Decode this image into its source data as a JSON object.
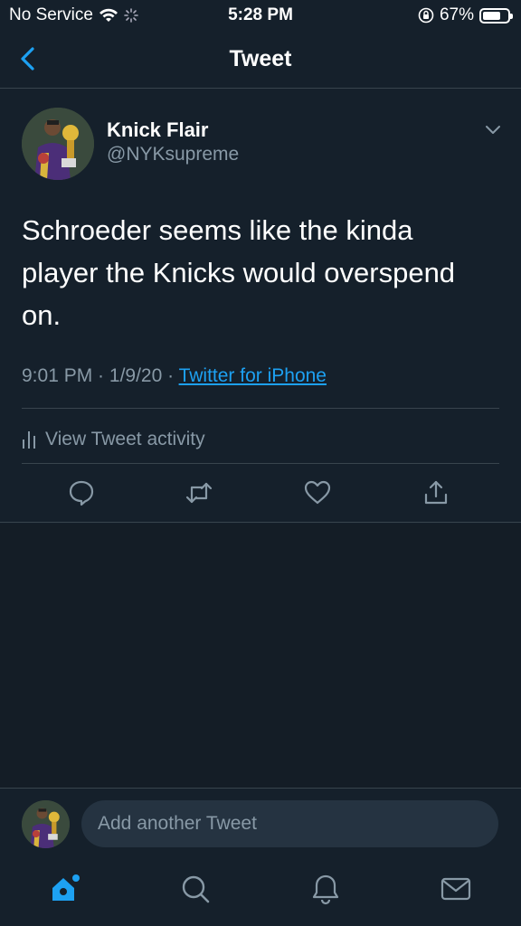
{
  "status_bar": {
    "carrier": "No Service",
    "time": "5:28 PM",
    "battery": "67%",
    "battery_level": 0.67
  },
  "nav": {
    "title": "Tweet",
    "back_icon": "chevron-left-icon"
  },
  "tweet": {
    "author_name": "Knick Flair",
    "author_handle": "@NYKsupreme",
    "text": "Schroeder seems like the kinda player the Knicks would overspend on.",
    "time": "9:01 PM",
    "date": "1/9/20",
    "separator": " · ",
    "source": "Twitter for iPhone",
    "activity_label": "View Tweet activity",
    "actions": [
      "reply-icon",
      "retweet-icon",
      "like-icon",
      "share-icon"
    ]
  },
  "composer": {
    "placeholder": "Add another Tweet"
  },
  "tab_bar": {
    "items": [
      "home-icon",
      "search-icon",
      "notifications-icon",
      "messages-icon"
    ]
  },
  "colors": {
    "background": "#15202b",
    "accent": "#1da1f2",
    "secondary_text": "#8899a6",
    "divider": "#38444d"
  }
}
